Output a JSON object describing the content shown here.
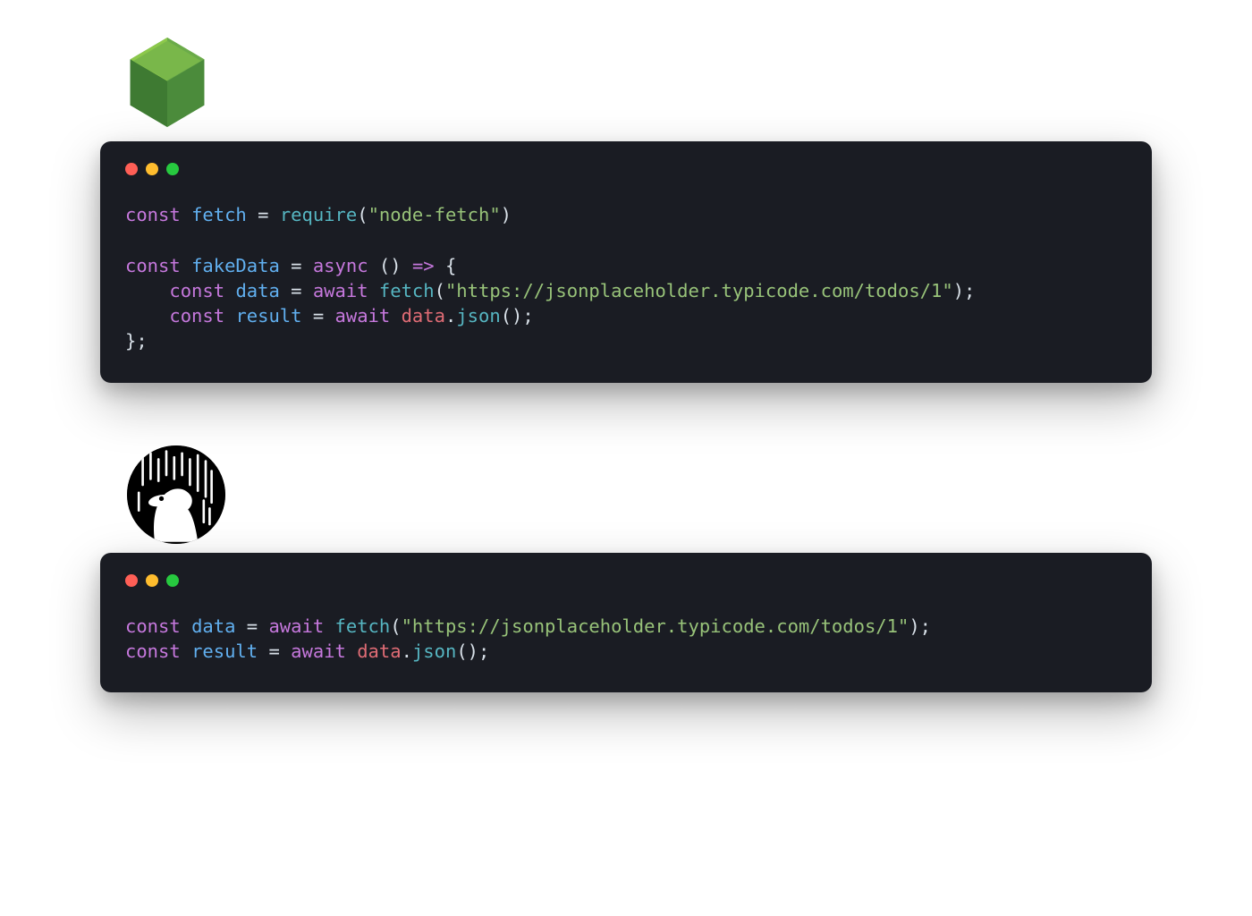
{
  "colors": {
    "window_bg": "#1a1c23",
    "dot_red": "#ff5f56",
    "dot_yellow": "#ffbd2e",
    "dot_green": "#27c93f",
    "kw": "#c678dd",
    "id": "#61afef",
    "fn": "#56b6c2",
    "str": "#98c379",
    "var": "#e06c75",
    "text": "#d8e0e8"
  },
  "node": {
    "tokens": {
      "const": "const",
      "fetchVar": "fetch",
      "eq": " = ",
      "require": "require",
      "lp": "(",
      "nodeFetchStr": "\"node-fetch\"",
      "rp": ")",
      "fakeData": "fakeData",
      "async": "async",
      "arrowOpen": " () ",
      "arrow": "=>",
      "braceOpen": " {",
      "indent": "    ",
      "dataVar": "data",
      "await": "await",
      "fetchFn": "fetch",
      "url": "\"https://jsonplaceholder.typicode.com/todos/1\"",
      "semi": ";",
      "resultVar": "result",
      "dot": ".",
      "jsonFn": "json",
      "emptyArgs": "()",
      "braceClose": "};"
    }
  },
  "deno": {
    "tokens": {
      "const": "const",
      "dataVar": "data",
      "eq": " = ",
      "await": "await",
      "fetchFn": "fetch",
      "lp": "(",
      "url": "\"https://jsonplaceholder.typicode.com/todos/1\"",
      "rp": ")",
      "semi": ";",
      "resultVar": "result",
      "dot": ".",
      "jsonFn": "json",
      "emptyArgs": "()"
    }
  }
}
